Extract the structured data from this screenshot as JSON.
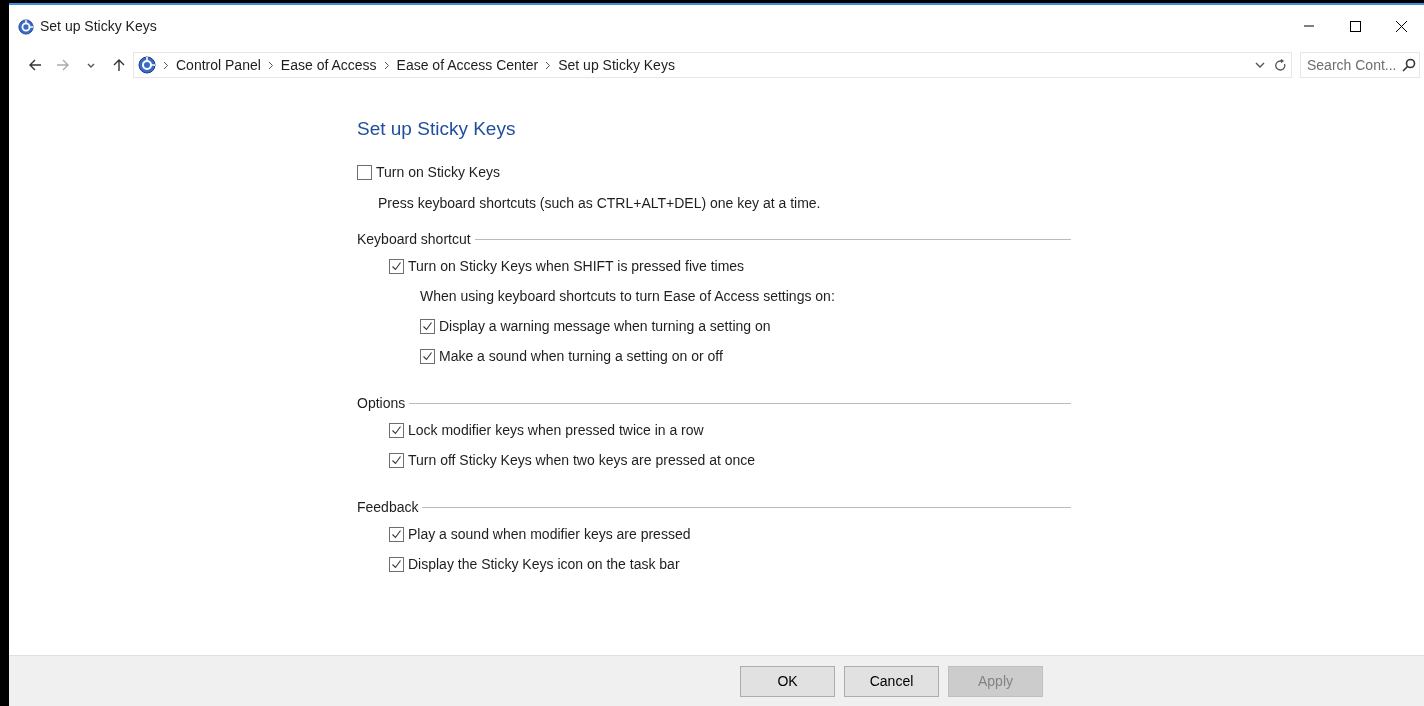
{
  "window": {
    "title": "Set up Sticky Keys"
  },
  "address_bar": {
    "breadcrumbs": [
      "Control Panel",
      "Ease of Access",
      "Ease of Access Center",
      "Set up Sticky Keys"
    ]
  },
  "search": {
    "placeholder": "Search Cont..."
  },
  "heading": "Set up Sticky Keys",
  "main_option": {
    "label": "Turn on Sticky Keys",
    "checked": false,
    "description": "Press keyboard shortcuts (such as CTRL+ALT+DEL) one key at a time."
  },
  "sections": [
    {
      "title": "Keyboard shortcut",
      "items": [
        {
          "kind": "checkbox",
          "label": "Turn on Sticky Keys when SHIFT is pressed five times",
          "checked": true,
          "children": [
            {
              "kind": "text",
              "label": "When using keyboard shortcuts to turn Ease of Access settings on:"
            },
            {
              "kind": "checkbox",
              "label": "Display a warning message when turning a setting on",
              "checked": true
            },
            {
              "kind": "checkbox",
              "label": "Make a sound when turning a setting on or off",
              "checked": true
            }
          ]
        }
      ]
    },
    {
      "title": "Options",
      "items": [
        {
          "kind": "checkbox",
          "label": "Lock modifier keys when pressed twice in a row",
          "checked": true
        },
        {
          "kind": "checkbox",
          "label": "Turn off Sticky Keys when two keys are pressed at once",
          "checked": true
        }
      ]
    },
    {
      "title": "Feedback",
      "items": [
        {
          "kind": "checkbox",
          "label": "Play a sound when modifier keys are pressed",
          "checked": true
        },
        {
          "kind": "checkbox",
          "label": "Display the Sticky Keys icon on the task bar",
          "checked": true
        }
      ]
    }
  ],
  "buttons": [
    {
      "label": "OK",
      "disabled": false
    },
    {
      "label": "Cancel",
      "disabled": false
    },
    {
      "label": "Apply",
      "disabled": true
    }
  ]
}
